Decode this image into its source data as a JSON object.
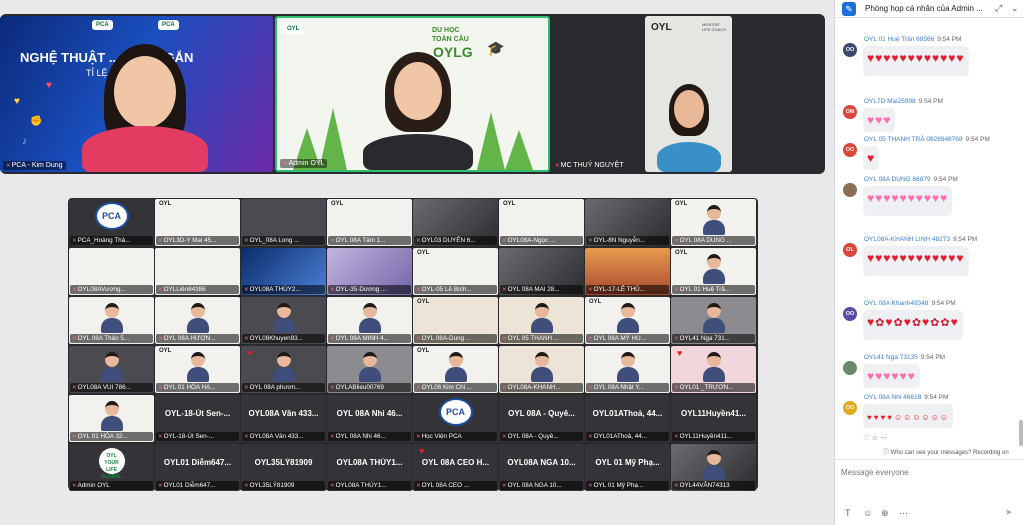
{
  "speakers": [
    {
      "name": "PCA - Kim Dung",
      "banner_title": "NGHỆ THUẬT ... DEO NGẮN",
      "banner_sub": "TỈ LỆ ..."
    },
    {
      "name": "Admin OYL",
      "banner_title_small": "DU HỌC\nTOÀN CẦU",
      "banner_big": "OYLG"
    },
    {
      "name": "MC THUÝ NGUYỆT",
      "logo": "OYL",
      "mentor": "MENTOR\nLIFE COACH"
    }
  ],
  "gallery": {
    "tiles": [
      "PCA_Hoàng Thả...",
      "OYL3D-Y Mai 45...",
      "OYL_08A Long ...",
      "OYL 08A Tâm 1...",
      "OYL03 DUYÊN 6...",
      "OYL08A-Ngọc ...",
      "OYL-8N Nguyễn...",
      "OYL 08A DUNG ...",
      "OYL08AVương...",
      "OYLLiên84386",
      "OYL08A THÚY2...",
      "OYL-35-Dương ...",
      "OYL-05 Lê Bích...",
      "OYL 08A MAI 28...",
      "OYL-17-LÊ THỦ...",
      "OYL 01 Huệ Trầ...",
      "OYL 08A Thảo 5...",
      "OYL 08A HƯƠN...",
      "OYL08Khuyen93...",
      "OYL 08A MINH 4...",
      "OYL 08A-Dung ...",
      "OYL 05 THANH ...",
      "OYL 08A MỸ HU...",
      "OYL41 Nga 731...",
      "OYL08A VUI 786...",
      "OYL 01 HÒA HẠ...",
      "OYL 08A phươn...",
      "OYLABlieu00769",
      "OYL06 Kim Chi ...",
      "OYL08A-KHANH...",
      "OYL 08A Nhật Y...",
      "OYL01 _TRƯƠN...",
      "OYL 01 HÒA 32...",
      "OYL-18-Út Sen-...",
      "OYL08A Vân 433...",
      "OYL 08A Nhi 46...",
      "Học Viện PCA",
      "OYL 08A - Quyê...",
      "OYL01AThoả, 44...",
      "OYL11Huyền411...",
      "Admin OYL",
      "OYL01 Diễm647...",
      "OYL35LÝ81909",
      "OYL08A THÚY1...",
      "OYL 08A CEO ...",
      "OYL 08A NGA 10...",
      "OYL 01 Mỹ Phạ...",
      "OYL44VÂN74313"
    ],
    "big_labels": {
      "33": "OYL-18-Út Sen-...",
      "34": "OYL08A Vân 433...",
      "35": "OYL 08A Nhi 46...",
      "37": "OYL 08A - Quyê...",
      "38": "OYL01AThoả, 44...",
      "39": "OYL11Huyền41...",
      "41": "OYL01 Diễm647...",
      "42": "OYL35LÝ81909",
      "43": "OYL08A THÚY1...",
      "44": "OYL 08A  CEO H...",
      "45": "OYL08A NGA 10...",
      "46": "OYL 01 Mỹ Phạ..."
    },
    "pca_badge": "PCA",
    "green_badge": "OYL\nYOUR LIFE\nGLOBAL",
    "oyl_logo": "OYL",
    "mentor_text": "MENTOR LIFE COACH"
  },
  "chat": {
    "title": "Phòng họp cá nhân của Admin ...",
    "header_buttons": [
      "⤢",
      "⌄"
    ],
    "messages": [
      {
        "initials": "OO",
        "avatar_color": "#3b4a6b",
        "name": "OYL 01 Huệ Trần 69566",
        "time": "9:54 PM",
        "emoji": "♥♥♥♥♥♥♥♥♥♥♥♥",
        "kind": "red"
      },
      {
        "initials": "OM",
        "avatar_color": "#d9473b",
        "name": "OYL7D Mai25998",
        "time": "9:54 PM",
        "emoji": "♥♥♥",
        "kind": "pink"
      },
      {
        "initials": "OO",
        "avatar_color": "#d9473b",
        "name": "OYL 05 THANH TRÀ 0828948768",
        "time": "9:54 PM",
        "emoji": "♥",
        "kind": "red"
      },
      {
        "initials": "",
        "avatar_color": "#8a6f54",
        "name": "OYL 08A DUNG 66879",
        "time": "9:54 PM",
        "emoji": "♥♥♥♥♥♥♥♥♥♥",
        "kind": "pink"
      },
      {
        "initials": "OL",
        "avatar_color": "#d9473b",
        "name": "OYL08A-KHANH LINH 48273",
        "time": "9:54 PM",
        "emoji": "♥♥♥♥♥♥♥♥♥♥♥♥",
        "kind": "red"
      },
      {
        "initials": "OO",
        "avatar_color": "#5b4aa8",
        "name": "OYL 08A Khanh49348",
        "time": "9:54 PM",
        "emoji": "♥✿♥✿♥✿♥✿✿♥",
        "kind": "rose"
      },
      {
        "initials": "",
        "avatar_color": "#6b8a6a",
        "name": "OYL41 Nga 73135",
        "time": "9:54 PM",
        "emoji": "♥♥♥♥♥♥",
        "kind": "pink"
      },
      {
        "initials": "OO",
        "avatar_color": "#e5a71d",
        "name": "OYL 08A Nhi 46618",
        "time": "9:54 PM",
        "emoji": "♥ ♥ ♥ ♥ ☺☺☺☺☺☺",
        "kind": "small"
      }
    ],
    "reaction_bar": "♡ ☺ ⋯",
    "privacy": "Who can see your messages? Recording on",
    "compose_placeholder": "Message everyone",
    "tools": [
      "T",
      "☺",
      "⊕",
      "⋯"
    ],
    "send_icon": "➤"
  }
}
